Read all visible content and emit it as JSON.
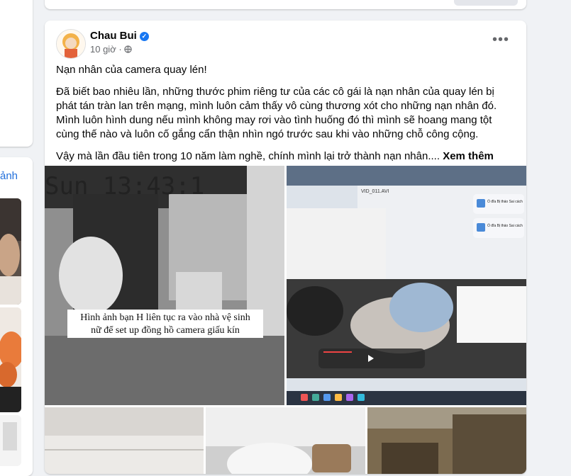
{
  "left_panel": {
    "link_text": "ảnh"
  },
  "post": {
    "author": "Chau Bui",
    "time": "10 giờ",
    "privacy_icon": "globe-icon",
    "verified_icon": "verified-badge-icon",
    "more_icon": "more-options-icon",
    "title": "Nạn nhân của camera quay lén!",
    "body": "Đã biết bao nhiêu lần, những thước phim riêng tư của các cô gái là nạn nhân của quay lén bị phát tán tràn lan trên mạng, mình luôn cảm thấy vô cùng thương xót cho những nạn nhân đó. Mình luôn hình dung nếu mình không may rơi vào tình huống đó thì mình sẽ hoang mang tột cùng thế nào và luôn cố gắng cẩn thận nhìn ngó trước sau khi vào những chỗ công cộng.",
    "excerpt": "Vậy mà lần đầu tiên trong 10 năm làm nghề, chính mình lại trở thành nạn nhân....",
    "see_more": "Xem thêm",
    "images": {
      "cctv_timestamp": "Sun 13:43:1",
      "cctv_caption_line1": "Hình ảnh bạn H liên tục ra vào nhà vệ sinh",
      "cctv_caption_line2": "nữ để set up đồng hồ camera giấu kín",
      "video_filename": "VID_011.AVI",
      "notif_text": "Ổ đĩa Bị tháo Sai cách",
      "notif_sub": "Gỡ \"Không có tiêu đề\" trước khi ngắt kết nối hoặc tắt."
    }
  }
}
